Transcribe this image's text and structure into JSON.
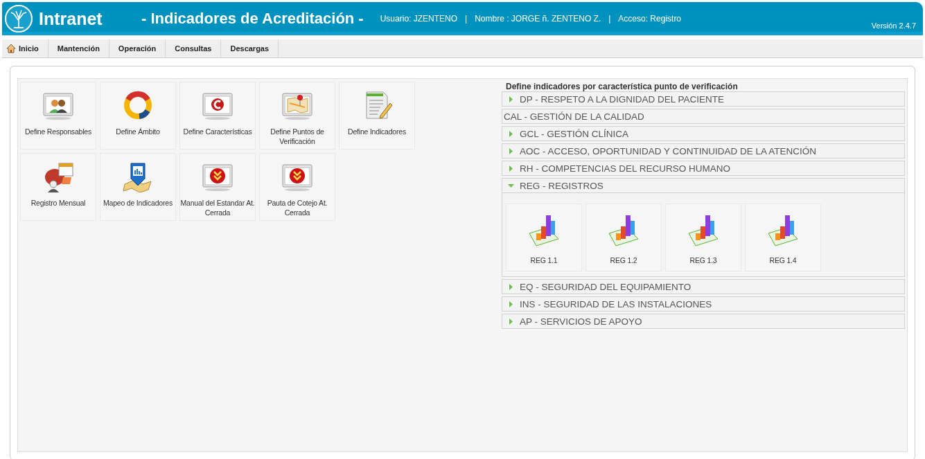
{
  "header": {
    "logo": "Intranet",
    "title": "- Indicadores de Acreditación -",
    "user": "Usuario: JZENTENO",
    "name": "Nombre : JORGE ñ. ZENTENO Z.",
    "access": "Acceso: Registro",
    "separators": [
      "|",
      "|"
    ],
    "version": "Versión 2.4.7"
  },
  "nav": [
    {
      "label": "Inicio",
      "kind": "home"
    },
    {
      "label": "Mantención",
      "kind": "plain"
    },
    {
      "label": "Operación",
      "kind": "plain"
    },
    {
      "label": "Consultas",
      "kind": "plain"
    },
    {
      "label": "Descargas",
      "kind": "plain"
    }
  ],
  "tiles": [
    {
      "label": "Define Responsables",
      "kind": "people"
    },
    {
      "label": "Define Ámbito",
      "kind": "ring"
    },
    {
      "label": "Define Características",
      "kind": "c-window"
    },
    {
      "label": "Define Puntos de Verificación",
      "kind": "map-window"
    },
    {
      "label": "Define Indicadores",
      "kind": "document"
    },
    {
      "label": "Registro Mensual",
      "kind": "calendar"
    },
    {
      "label": "Mapeo de Indicadores",
      "kind": "map-pin"
    },
    {
      "label": "Manual del Estandar At. Cerrada",
      "kind": "down-window"
    },
    {
      "label": "Pauta de Cotejo At. Cerrada",
      "kind": "down-window"
    }
  ],
  "accordion": {
    "title": "Define indicadores por característica punto de verificación",
    "sections": [
      {
        "label": "DP - RESPETO A LA DIGNIDAD DEL PACIENTE",
        "kind": "arrow",
        "expanded": false
      },
      {
        "label": "CAL - GESTIÓN DE LA CALIDAD",
        "kind": "plain",
        "expanded": false
      },
      {
        "label": "GCL - GESTIÓN CLÍNICA",
        "kind": "arrow",
        "expanded": false
      },
      {
        "label": "AOC - ACCESO, OPORTUNIDAD Y CONTINUIDAD DE LA ATENCIÓN",
        "kind": "arrow",
        "expanded": false
      },
      {
        "label": "RH - COMPETENCIAS DEL RECURSO HUMANO",
        "kind": "arrow",
        "expanded": false
      },
      {
        "label": "REG - REGISTROS",
        "kind": "arrow",
        "expanded": true,
        "children": [
          "REG 1.1",
          "REG 1.2",
          "REG 1.3",
          "REG 1.4"
        ]
      },
      {
        "label": "EQ - SEGURIDAD DEL EQUIPAMIENTO",
        "kind": "arrow",
        "expanded": false
      },
      {
        "label": "INS - SEGURIDAD DE LAS INSTALACIONES",
        "kind": "arrow",
        "expanded": false
      },
      {
        "label": "AP - SERVICIOS DE APOYO",
        "kind": "arrow",
        "expanded": false
      }
    ]
  }
}
